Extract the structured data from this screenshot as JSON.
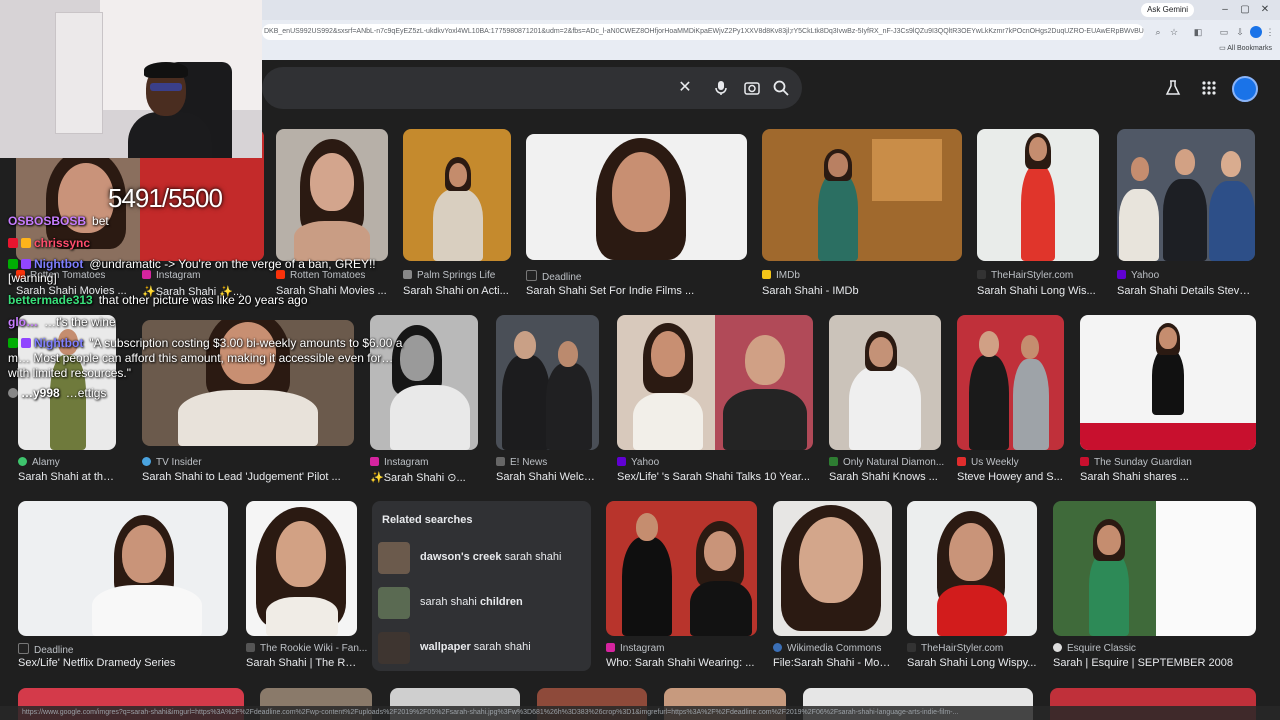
{
  "browser": {
    "ask_gemini": "Ask Gemini",
    "url": "DKB_enUS992US992&sxsrf=ANbL-n7c9qEyEZ5zL-ukdkvYoxl4WL10BA:1775980871201&udm=2&fbs=ADc_l-aN0CWEZ8OHfjorHoaMMDiKpaEWjvZ2Py1XXV8d8Kv83jl;rY5CkLtk8Dq3IvwBz-5IyfRX_nF-J3Cs9lQZu9I3QQltR3OEYwLkKzmr7kPOcnOHgs2DuqUZRO-EUAwERpBWvBU8CtC1Ox4d...",
    "all_bookmarks": "All Bookmarks"
  },
  "search_bar": {
    "clear_icon": "close-icon",
    "voice_icon": "mic-icon",
    "lens_icon": "camera-icon",
    "search_icon": "search-icon"
  },
  "stream": {
    "counter": "5491/5500",
    "chat": [
      {
        "user": "OSBOSBOSB",
        "user_color": "#c77dff",
        "text": "bet"
      },
      {
        "user": "chrissync",
        "user_color": "#ff4d6d",
        "text": ""
      },
      {
        "user": "Nightbot",
        "user_color": "#7f7fff",
        "text": "@undramatic -> You're on the verge of a ban, GREY!! [warning]"
      },
      {
        "user": "bettermade313",
        "user_color": "#39e07a",
        "text": "that other picture was like 20 years ago"
      },
      {
        "user": "glo…",
        "user_color": "#c77dff",
        "text": "…t's the wine"
      },
      {
        "user": "Nightbot",
        "user_color": "#7f7fff",
        "text": "\"A subscription costing $3.00 bi-weekly amounts to $6.00 a m… Most people can afford this amount, making it accessible even for… with limited resources.\""
      },
      {
        "user": "…y998",
        "user_color": "#ffffff",
        "text": "…ettigs"
      }
    ]
  },
  "row1": [
    {
      "source": "Rotten Tomatoes",
      "title": "Sarah Shahi Movies ..."
    },
    {
      "source": "Instagram",
      "title": "✨Sarah Shahi ✨..."
    },
    {
      "source": "Rotten Tomatoes",
      "title": "Sarah Shahi Movies ..."
    },
    {
      "source": "Palm Springs Life",
      "title": "Sarah Shahi on Acti..."
    },
    {
      "source": "Deadline",
      "title": "Sarah Shahi Set For Indie Films ..."
    },
    {
      "source": "IMDb",
      "title": "Sarah Shahi - IMDb"
    },
    {
      "source": "TheHairStyler.com",
      "title": "Sarah Shahi Long Wis..."
    },
    {
      "source": "Yahoo",
      "title": "Sarah Shahi Details Steve ..."
    }
  ],
  "row2": [
    {
      "source": "Alamy",
      "title": "Sarah Shahi at the ..."
    },
    {
      "source": "TV Insider",
      "title": "Sarah Shahi to Lead 'Judgement' Pilot ..."
    },
    {
      "source": "Instagram",
      "title": "✨Sarah Shahi ⊙..."
    },
    {
      "source": "E! News",
      "title": "Sarah Shahi Welco..."
    },
    {
      "source": "Yahoo",
      "title": "Sex/Life' 's Sarah Shahi Talks 10 Year..."
    },
    {
      "source": "Only Natural Diamon...",
      "title": "Sarah Shahi Knows ..."
    },
    {
      "source": "Us Weekly",
      "title": "Steve Howey and S..."
    },
    {
      "source": "The Sunday Guardian",
      "title": "Sarah Shahi shares ..."
    }
  ],
  "row3": [
    {
      "source": "Deadline",
      "title": "Sex/Life' Netflix Dramedy Series"
    },
    {
      "source": "The Rookie Wiki - Fan...",
      "title": "Sarah Shahi | The Ro..."
    },
    {
      "source": "Instagram",
      "title": "Who: Sarah Shahi Wearing: ..."
    },
    {
      "source": "Wikimedia Commons",
      "title": "File:Sarah Shahi - Mon..."
    },
    {
      "source": "TheHairStyler.com",
      "title": "Sarah Shahi Long Wispy..."
    },
    {
      "source": "Esquire Classic",
      "title": "Sarah | Esquire | SEPTEMBER 2008"
    }
  ],
  "related": {
    "title": "Related searches",
    "items": [
      {
        "bold": "dawson's creek",
        "rest": " sarah shahi",
        "bold_first": true
      },
      {
        "bold": "children",
        "rest": "sarah shahi ",
        "bold_first": false
      },
      {
        "bold": "wallpaper",
        "rest": " sarah shahi",
        "bold_first": true
      }
    ]
  },
  "status_url": "https://www.google.com/imgres?q=sarah-shahi&imgurl=https%3A%2F%2Fdeadline.com%2Fwp-content%2Fuploads%2F2019%2F05%2Fsarah-shahi.jpg%3Fw%3D681%26h%3D383%26crop%3D1&imgrefurl=https%3A%2F%2Fdeadline.com%2F2019%2F06%2Fsarah-shahi-language-arts-indie-film-...",
  "colors": {
    "page_bg": "#1f1f1f",
    "panel_bg": "#303134",
    "text": "#e8eaed",
    "muted": "#bdc1c6"
  }
}
